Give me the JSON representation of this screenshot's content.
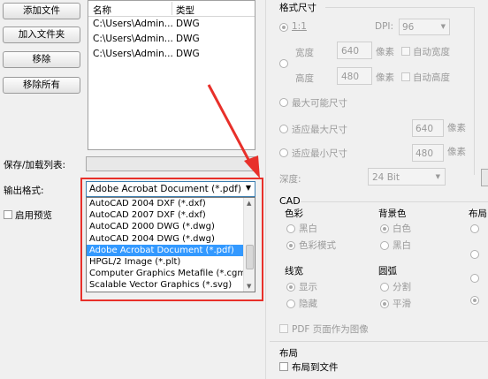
{
  "left_buttons": {
    "add_file": "添加文件",
    "add_folder": "加入文件夹",
    "remove": "移除",
    "remove_all": "移除所有"
  },
  "file_list": {
    "col_name": "名称",
    "col_type": "类型",
    "rows": [
      {
        "name": "C:\\Users\\Admin...",
        "type": "DWG"
      },
      {
        "name": "C:\\Users\\Admin...",
        "type": "DWG"
      },
      {
        "name": "C:\\Users\\Admin...",
        "type": "DWG"
      }
    ]
  },
  "save_load_label": "保存/加载列表:",
  "output_format_label": "输出格式:",
  "output_format_value": "Adobe Acrobat Document (*.pdf)",
  "enable_preview_label": "启用预览",
  "format_options": [
    "AutoCAD 2004 DXF (*.dxf)",
    "AutoCAD 2007 DXF (*.dxf)",
    "AutoCAD 2000 DWG (*.dwg)",
    "AutoCAD 2004 DWG (*.dwg)",
    "Adobe Acrobat Document (*.pdf)",
    "HPGL/2 Image (*.plt)",
    "Computer Graphics Metafile (*.cgm)",
    "Scalable Vector Graphics (*.svg)"
  ],
  "selected_option_index": 4,
  "size": {
    "section_title": "格式尺寸",
    "ratio_label": "1:1",
    "dpi_label": "DPI:",
    "dpi_value": "96",
    "width_label": "宽度",
    "width_value": "640",
    "height_label": "高度",
    "height_value": "480",
    "px_unit": "像素",
    "auto_width": "自动宽度",
    "auto_height": "自动高度",
    "max_possible": "最大可能尺寸",
    "fit_max": "适应最大尺寸",
    "fit_max_value": "640",
    "fit_min": "适应最小尺寸",
    "fit_min_value": "480",
    "depth_label": "深度:",
    "depth_value": "24 Bit"
  },
  "cad": {
    "section_title": "CAD",
    "color_group": "色彩",
    "color_bw": "黑白",
    "color_mode": "色彩模式",
    "bg_group": "背景色",
    "bg_white": "白色",
    "bg_black": "黑白",
    "layout_group": "布局",
    "lw_group": "线宽",
    "lw_show": "显示",
    "lw_hide": "隐藏",
    "arc_group": "圆弧",
    "arc_split": "分割",
    "arc_smooth": "平滑",
    "pdf_as_image": "PDF 页面作为图像"
  },
  "layout_section": {
    "title": "布局",
    "layout_to_file": "布局到文件"
  }
}
